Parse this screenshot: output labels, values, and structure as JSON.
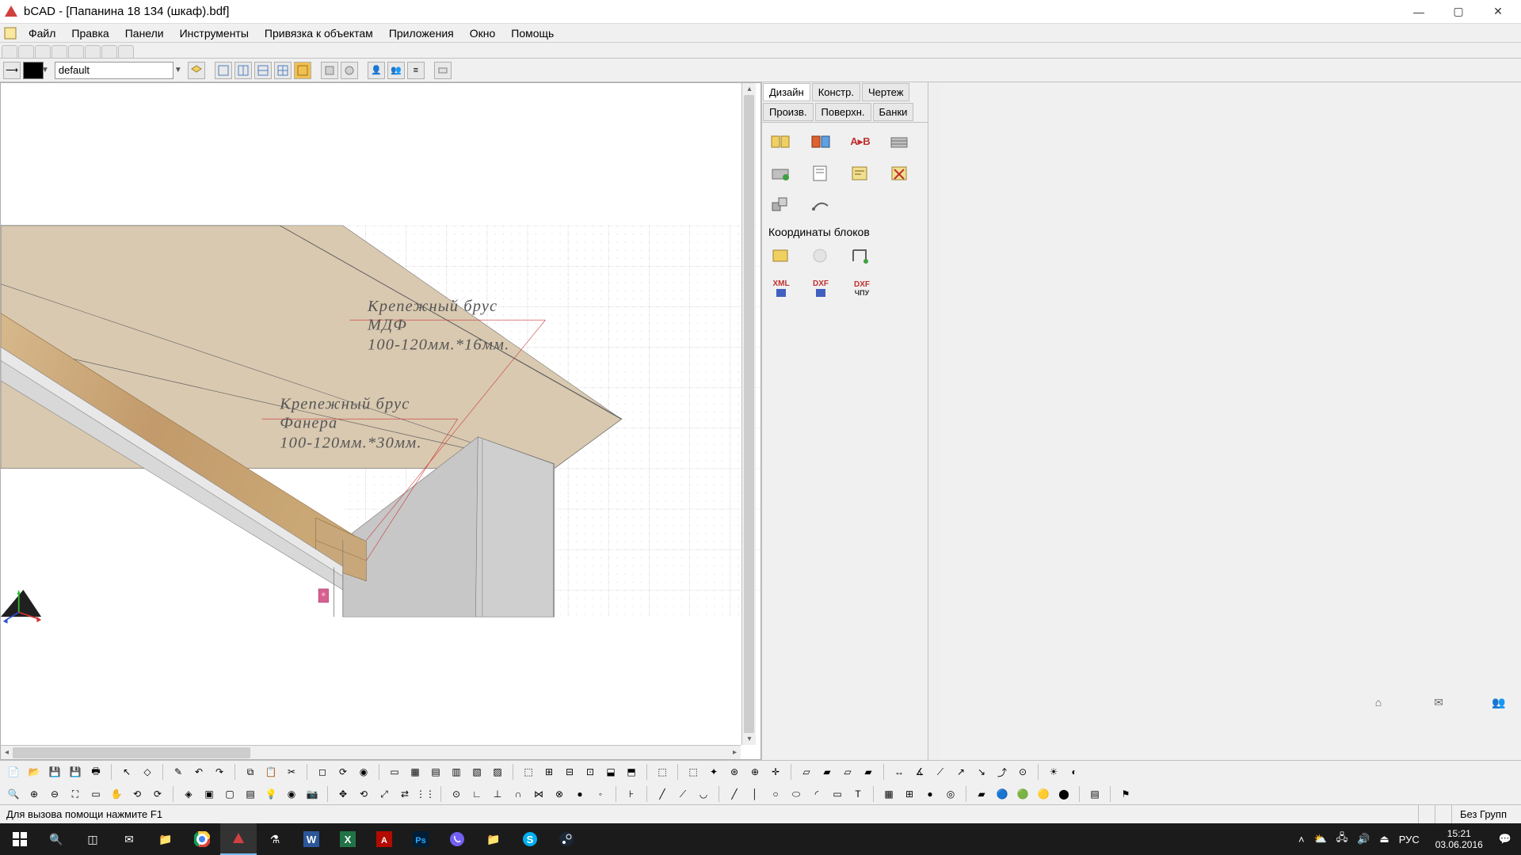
{
  "title": "bCAD - [Папанина 18 134 (шкаф).bdf]",
  "menubar": [
    "Файл",
    "Правка",
    "Панели",
    "Инструменты",
    "Привязка к объектам",
    "Приложения",
    "Окно",
    "Помощь"
  ],
  "layer": "default",
  "sidepanel_tabs_row1": [
    "Дизайн",
    "Констр.",
    "Чертеж",
    "Произв."
  ],
  "sidepanel_tabs_row2": [
    "Поверхн.",
    "Банки"
  ],
  "sidepanel_section": "Координаты блоков",
  "a_to_b": "A▸B",
  "dxf_labels": [
    "XML",
    "DXF",
    "DXF"
  ],
  "dxf_sub": [
    "",
    "",
    "ЧПУ"
  ],
  "annotation1": {
    "l1": "Крепежный  брус",
    "l2": "МДФ",
    "l3": "100-120мм.*16мм."
  },
  "annotation2": {
    "l1": "Крепежный  брус",
    "l2": "Фанера",
    "l3": "100-120мм.*30мм."
  },
  "status_hint": "Для вызова помощи нажмите F1",
  "status_group": "Без Групп",
  "tray_lang": "РУС",
  "clock_time": "15:21",
  "clock_date": "03.06.2016",
  "colors": {
    "panel_beige": "#d9c9b0",
    "wood": "#c8a87a",
    "wood_dark": "#b08d5e",
    "side_grey": "#c7c7c7",
    "edge_dark": "#606060"
  }
}
